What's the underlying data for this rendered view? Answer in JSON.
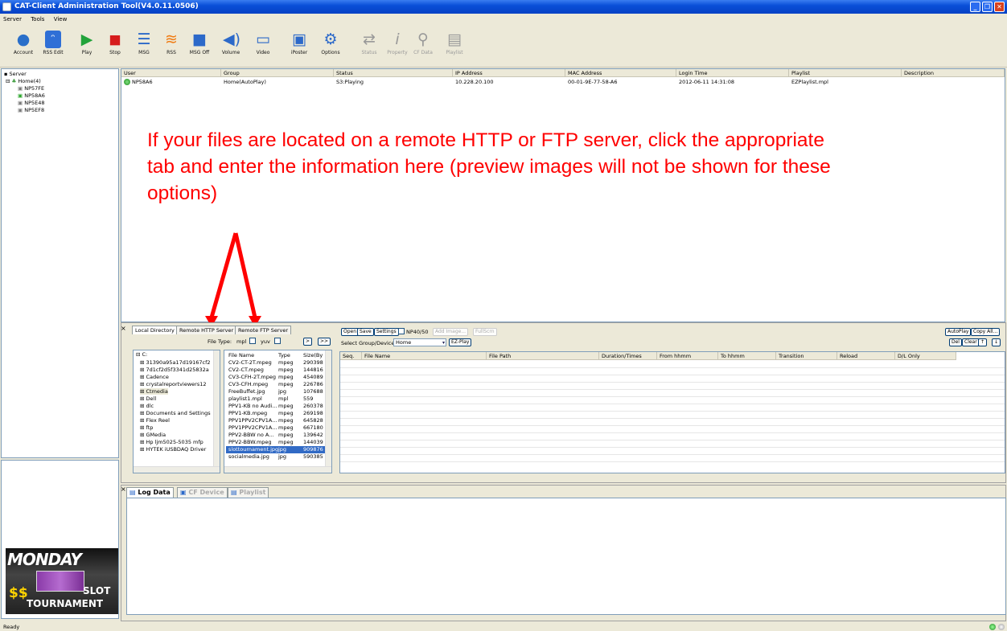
{
  "window": {
    "title": "CAT-Client Administration Tool(V4.0.11.0506)"
  },
  "menu": [
    "Server",
    "Tools",
    "View"
  ],
  "toolbar": [
    {
      "label": "Account",
      "icon": "account-icon"
    },
    {
      "label": "RSS Edit",
      "icon": "rss-edit-icon"
    },
    {
      "label": "Play",
      "icon": "play-icon"
    },
    {
      "label": "Stop",
      "icon": "stop-icon"
    },
    {
      "label": "MSG",
      "icon": "message-icon"
    },
    {
      "label": "RSS",
      "icon": "rss-icon"
    },
    {
      "label": "MSG Off",
      "icon": "message-off-icon"
    },
    {
      "label": "Volume",
      "icon": "volume-icon"
    },
    {
      "label": "Video",
      "icon": "video-icon"
    },
    {
      "label": "iPoster",
      "icon": "iposter-icon"
    },
    {
      "label": "Options",
      "icon": "options-icon"
    },
    {
      "label": "Status",
      "icon": "status-icon"
    },
    {
      "label": "Property",
      "icon": "property-icon"
    },
    {
      "label": "CF Data",
      "icon": "cf-data-icon"
    },
    {
      "label": "Playlist",
      "icon": "playlist-icon"
    }
  ],
  "tree": {
    "root": "Server",
    "group": "Home(4)",
    "devices": [
      "NP57FE",
      "NP58A6",
      "NP5E48",
      "NP5EF8"
    ]
  },
  "grid": {
    "columns": [
      "User",
      "Group",
      "Status",
      "IP Address",
      "MAC Address",
      "Login Time",
      "Playlist",
      "Description"
    ],
    "rows": [
      [
        "NP58A6",
        "Home(AutoPlay)",
        "S3:Playing",
        "10.228.20.100",
        "00-01-9E-77-58-A6",
        "2012-06-11 14:31:08",
        "EZPlaylist.mpl",
        ""
      ]
    ]
  },
  "annotation": {
    "text": "If your files are located on a remote HTTP or FTP server, click the appropriate tab and enter the information here (preview images will not be shown for these options)",
    "arrow_color": "#ff0000"
  },
  "source_tabs": [
    "Local Directory",
    "Remote HTTP Server",
    "Remote FTP Server"
  ],
  "filetype": {
    "label": "File Type:",
    "mpl": "mpl",
    "yuv": "yuv",
    "next": ">",
    "all": ">>"
  },
  "playlist_buttons": {
    "open": "Open",
    "save": "Save",
    "settings": "Settings",
    "np": "NP40/50",
    "add_image": "Add Image...",
    "fullscrn": "FullScrn",
    "autoplay": "AutoPlay",
    "copy_all": "Copy All...",
    "del": "Del",
    "clear": "Clear",
    "up": "↑",
    "down": "↓"
  },
  "group_select": {
    "label": "Select Group/Device",
    "value": "Home",
    "ezplay": "EZ-Play"
  },
  "folders": [
    "C:",
    "31390a95a17d19167cf2",
    "7d1cf2d5f3341d25832a",
    "Cadence",
    "crystalreportviewers12",
    "Ctmedia",
    "Dell",
    "dlc",
    "Documents and Settings",
    "Flex Reel",
    "ftp",
    "GMedia",
    "Hp ljm5025-5035 mfp",
    "HYTEK iUSBDAQ Driver"
  ],
  "files": {
    "columns": [
      "File Name",
      "Type",
      "Size(By"
    ],
    "rows": [
      [
        "CV2-CT-2T.mpeg",
        "mpeg",
        "290398"
      ],
      [
        "CV2-CT.mpeg",
        "mpeg",
        "144816"
      ],
      [
        "CV3-CFH-2T.mpeg",
        "mpeg",
        "454089"
      ],
      [
        "CV3-CFH.mpeg",
        "mpeg",
        "226786"
      ],
      [
        "FreeBuffet.jpg",
        "jpg",
        "107688"
      ],
      [
        "playlist1.mpl",
        "mpl",
        "559"
      ],
      [
        "PPV1-KB no Audi...",
        "mpeg",
        "260378"
      ],
      [
        "PPV1-KB.mpeg",
        "mpeg",
        "269198"
      ],
      [
        "PPV1PPV2CPV1A...",
        "mpeg",
        "645828"
      ],
      [
        "PPV1PPV2CPV1A...",
        "mpeg",
        "667180"
      ],
      [
        "PPV2-BBW no A...",
        "mpeg",
        "139642"
      ],
      [
        "PPV2-BBW.mpeg",
        "mpeg",
        "144039"
      ],
      [
        "slottournament.jpg",
        "jpg",
        "909876"
      ],
      [
        "socialmedia.jpg",
        "jpg",
        "590385"
      ]
    ],
    "selected_index": 12
  },
  "seq_columns": [
    "Seq.",
    "File Name",
    "File Path",
    "Duration/Times",
    "From hhmm",
    "To hhmm",
    "Transition",
    "Reload",
    "D/L Only"
  ],
  "log_tabs": [
    "Log Data",
    "CF Device",
    "Playlist"
  ],
  "banner": {
    "line1": "MONDAY",
    "line2": "SLOT",
    "line3": "TOURNAMENT",
    "dollars": "$$"
  },
  "status": "Ready",
  "colors": {
    "accent": "#0a4fd8",
    "annotation": "#ff0000",
    "online": "#2aa52a"
  }
}
